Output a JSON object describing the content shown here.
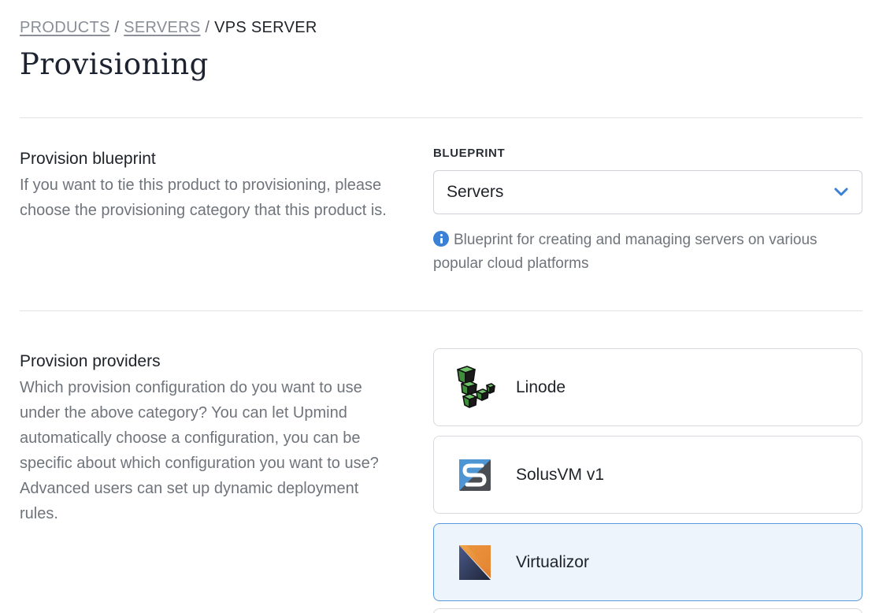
{
  "breadcrumb": {
    "items": [
      "PRODUCTS",
      "SERVERS"
    ],
    "separator": "/",
    "current": "VPS SERVER"
  },
  "page_title": "Provisioning",
  "blueprint_section": {
    "title": "Provision blueprint",
    "description": "If you want to tie this product to provisioning, please choose the provisioning category that this product is.",
    "field_label": "BLUEPRINT",
    "selected_value": "Servers",
    "hint": "Blueprint for creating and managing servers on various popular cloud platforms",
    "icons": {
      "dropdown": "chevron-down-icon",
      "hint": "info-icon"
    },
    "colors": {
      "accent": "#3b82d6"
    }
  },
  "providers_section": {
    "title": "Provision providers",
    "description": "Which provision configuration do you want to use under the above category? You can let Upmind automatically choose a configuration, you can be specific about which configuration you want to use? Advanced users can set up dynamic deployment rules.",
    "providers": [
      {
        "name": "Linode",
        "icon": "linode-logo-icon",
        "selected": false
      },
      {
        "name": "SolusVM v1",
        "icon": "solusvm-logo-icon",
        "selected": false
      },
      {
        "name": "Virtualizor",
        "icon": "virtualizor-logo-icon",
        "selected": true
      }
    ],
    "colors": {
      "selected_border": "#5a9be0",
      "selected_background": "#edf4fc"
    }
  }
}
